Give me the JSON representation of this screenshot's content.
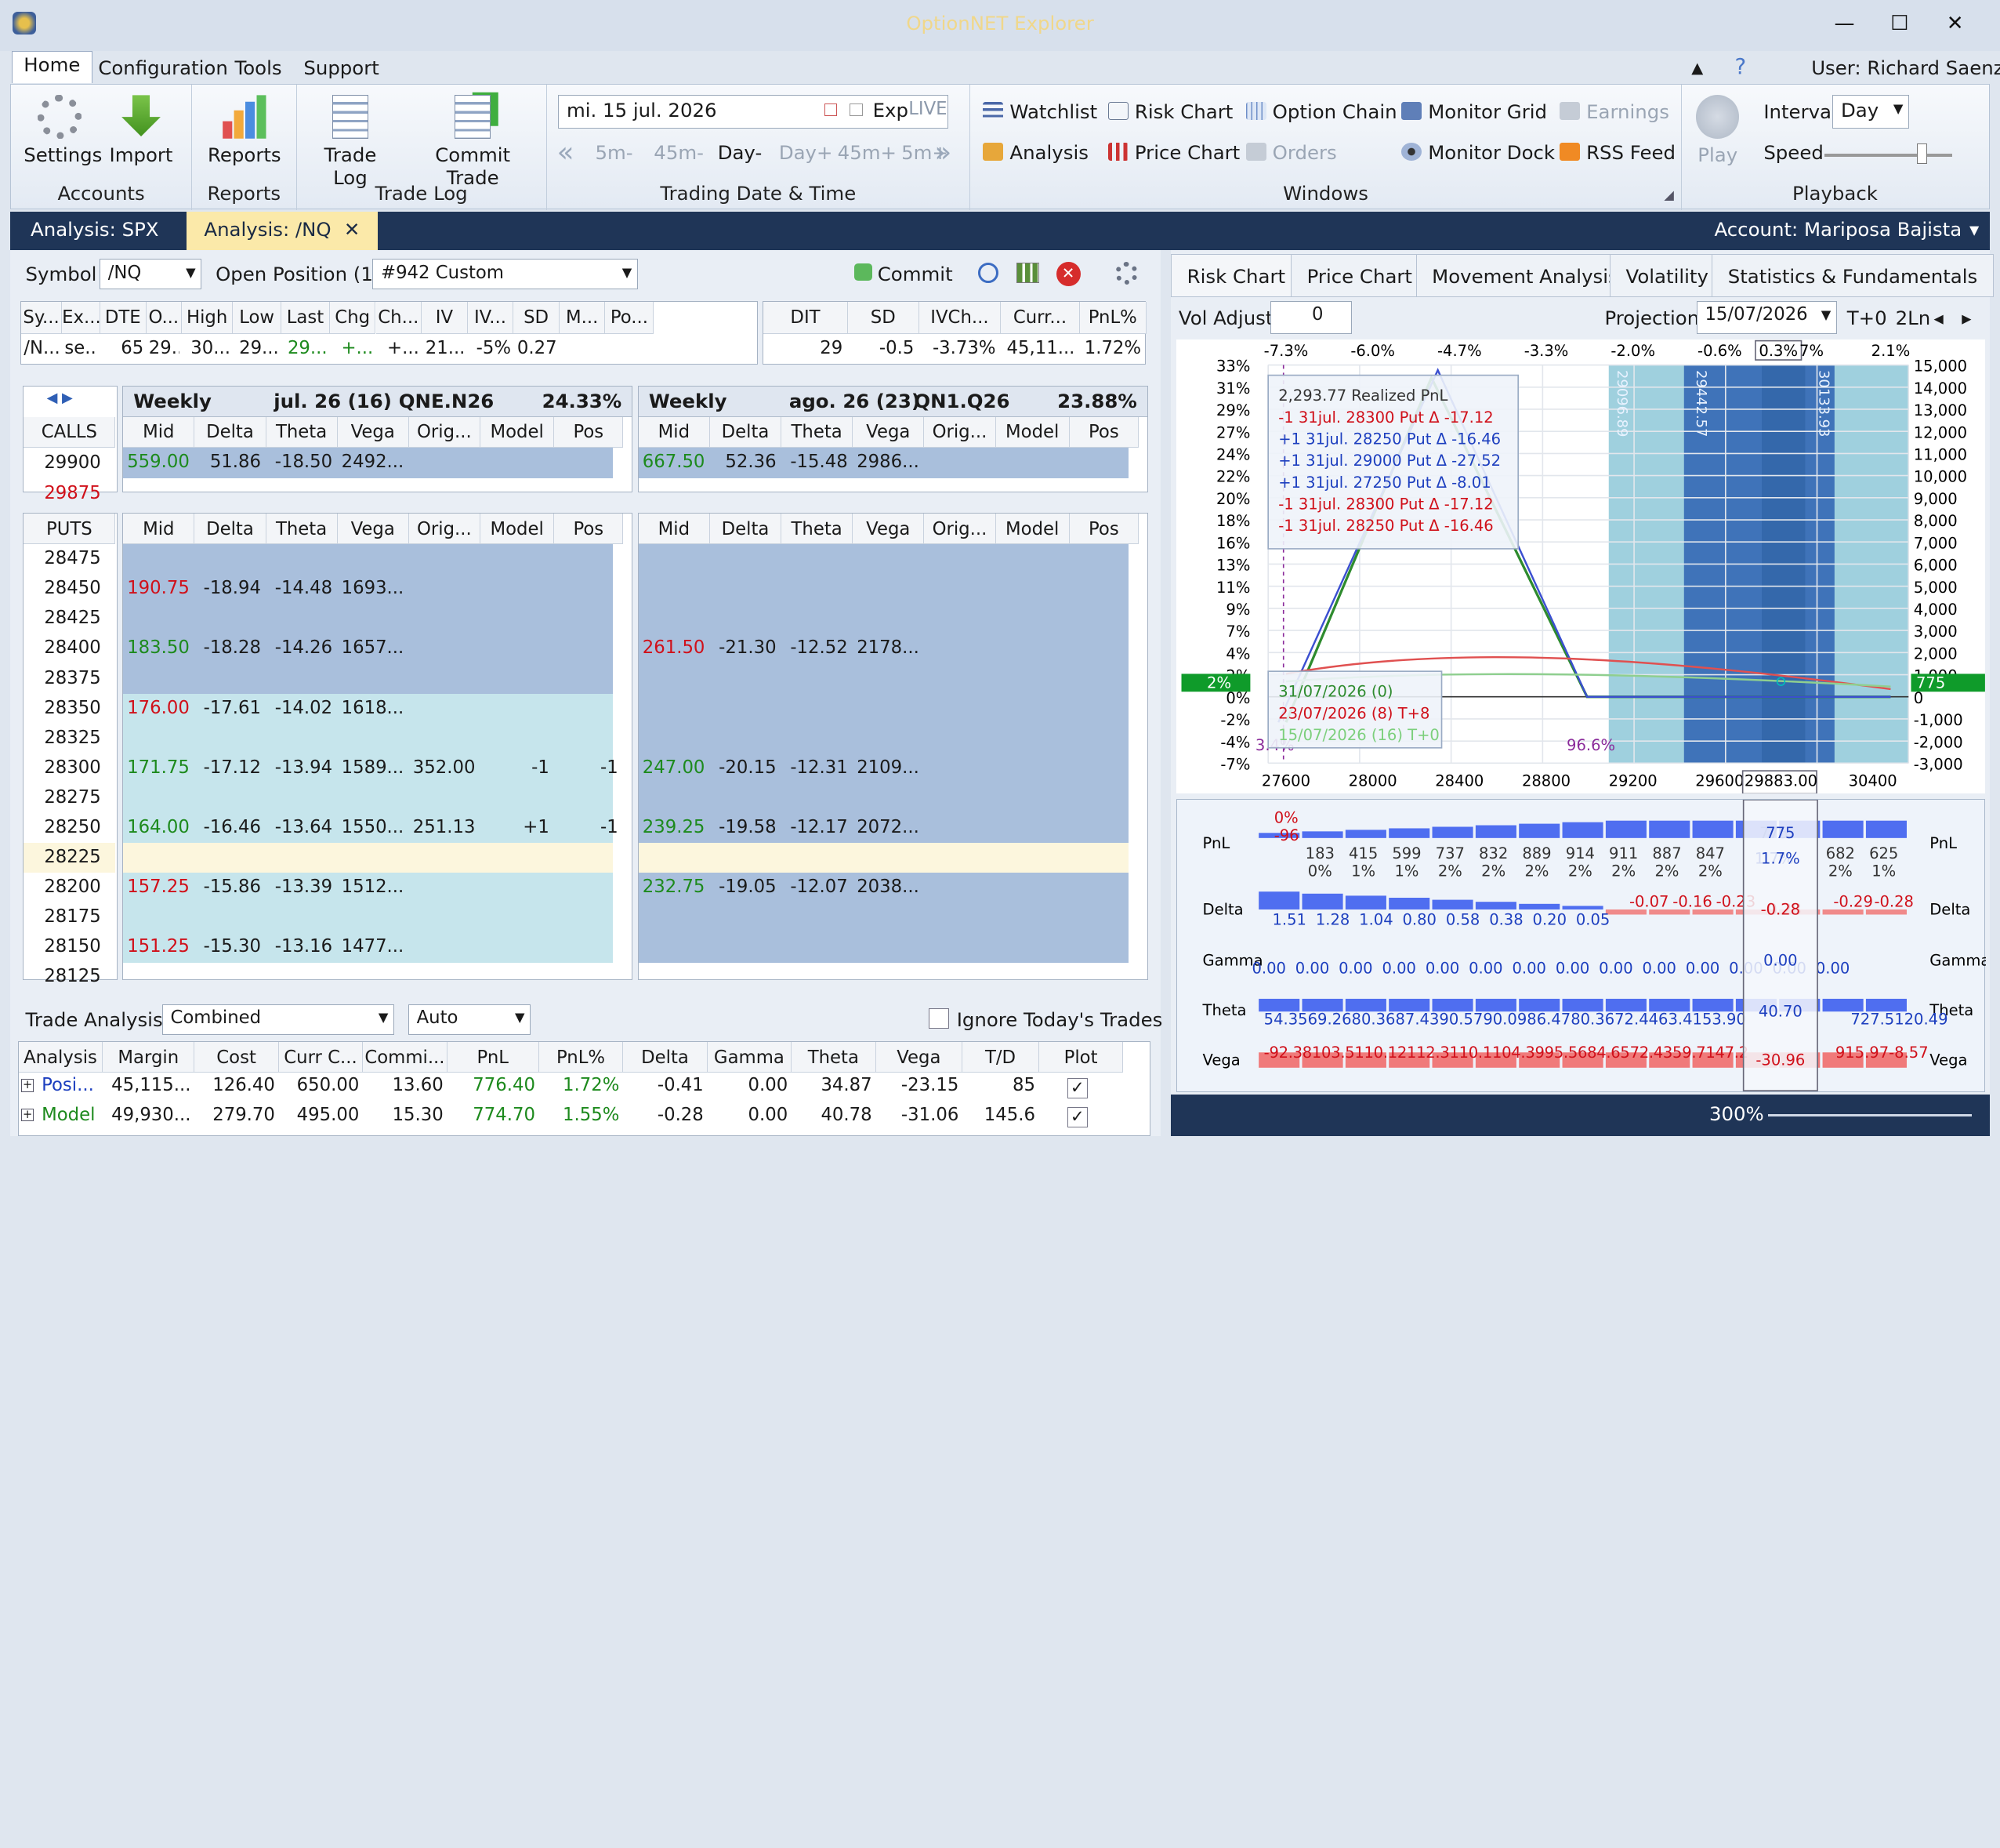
{
  "app": {
    "title": "OptionNET Explorer",
    "user": "User: Richard Saenz"
  },
  "menu": [
    "Home",
    "Configuration",
    "Tools",
    "Support"
  ],
  "ribbon": {
    "accounts": {
      "label": "Accounts",
      "settings": "Settings",
      "import": "Import"
    },
    "reports": {
      "label": "Reports",
      "reports": "Reports"
    },
    "tradelog": {
      "label": "Trade Log",
      "trade_log": "Trade Log",
      "commit_trade": "Commit Trade"
    },
    "trading": {
      "label": "Trading Date & Time",
      "date": "mi. 15 jul. 2026",
      "exp": "Exp",
      "live": "LIVE",
      "steps": [
        "5m-",
        "45m-",
        "Day-",
        "Day+",
        "45m+",
        "5m+"
      ]
    },
    "windows": {
      "label": "Windows",
      "items": [
        "Watchlist",
        "Risk Chart",
        "Option Chain",
        "Monitor Grid",
        "Earnings",
        "Analysis",
        "Price Chart",
        "Orders",
        "Monitor Dock",
        "RSS Feed"
      ]
    },
    "playback": {
      "label": "Playback",
      "play": "Play",
      "interval_label": "Interval",
      "interval": "Day",
      "speed_label": "Speed"
    }
  },
  "doc_tabs": [
    "Analysis: SPX",
    "Analysis: /NQ"
  ],
  "account": "Account: Mariposa Bajista",
  "left": {
    "symbol_label": "Symbol",
    "symbol": "/NQ",
    "open_pos_label": "Open Position (1)",
    "position": "#942 Custom",
    "commit": "Commit",
    "quote_headers": [
      "Sy...",
      "Ex...",
      "DTE",
      "O...",
      "High",
      "Low",
      "Last",
      "Chg",
      "Ch...",
      "IV",
      "IV...",
      "SD",
      "M...",
      "Po..."
    ],
    "quote_values": [
      "/N...",
      "se...",
      "65",
      "29...",
      "30...",
      "29...",
      "29...",
      "+...",
      "+...",
      "21...",
      "-5%",
      "0.27",
      "",
      ""
    ],
    "pos_headers": [
      "DIT",
      "SD",
      "IVCh...",
      "Curr...",
      "PnL%"
    ],
    "pos_values": [
      "29",
      "-0.5",
      "-3.73%",
      "45,11...",
      "1.72%"
    ],
    "exp1": {
      "name": "Weekly",
      "date": "jul. 26 (16)",
      "code": "QNE.N26",
      "iv": "24.33%"
    },
    "exp2": {
      "name": "Weekly",
      "date": "ago. 26 (23)",
      "code": "QN1.Q26",
      "iv": "23.88%"
    },
    "opt_cols": [
      "Mid",
      "Delta",
      "Theta",
      "Vega",
      "Orig...",
      "Model",
      "Pos"
    ],
    "calls_label": "CALLS",
    "puts_label": "PUTS",
    "calls": [
      {
        "strike": "29900",
        "a": [
          "559.00",
          "51.86",
          "-18.50",
          "2492...",
          "",
          "",
          ""
        ],
        "b": [
          "667.50",
          "52.36",
          "-15.48",
          "2986...",
          "",
          "",
          ""
        ]
      },
      {
        "strike": "29875",
        "a": [],
        "b": []
      }
    ],
    "puts": [
      {
        "strike": "28475",
        "a": [
          "",
          "",
          "",
          "",
          "",
          "",
          ""
        ],
        "b": [
          "",
          "",
          "",
          "",
          "",
          "",
          ""
        ]
      },
      {
        "strike": "28450",
        "a": [
          "190.75",
          "-18.94",
          "-14.48",
          "1693...",
          "",
          "",
          ""
        ],
        "b": [
          "",
          "",
          "",
          "",
          "",
          "",
          ""
        ]
      },
      {
        "strike": "28425",
        "a": [
          "",
          "",
          "",
          "",
          "",
          "",
          ""
        ],
        "b": [
          "",
          "",
          "",
          "",
          "",
          "",
          ""
        ]
      },
      {
        "strike": "28400",
        "a": [
          "183.50",
          "-18.28",
          "-14.26",
          "1657...",
          "",
          "",
          ""
        ],
        "b": [
          "261.50",
          "-21.30",
          "-12.52",
          "2178...",
          "",
          "",
          ""
        ]
      },
      {
        "strike": "28375",
        "a": [
          "",
          "",
          "",
          "",
          "",
          "",
          ""
        ],
        "b": [
          "",
          "",
          "",
          "",
          "",
          "",
          ""
        ]
      },
      {
        "strike": "28350",
        "a": [
          "176.00",
          "-17.61",
          "-14.02",
          "1618...",
          "",
          "",
          ""
        ],
        "b": [
          "",
          "",
          "",
          "",
          "",
          "",
          ""
        ]
      },
      {
        "strike": "28325",
        "a": [
          "",
          "",
          "",
          "",
          "",
          "",
          ""
        ],
        "b": [
          "",
          "",
          "",
          "",
          "",
          "",
          ""
        ]
      },
      {
        "strike": "28300",
        "a": [
          "171.75",
          "-17.12",
          "-13.94",
          "1589...",
          "352.00",
          "-1",
          "-1"
        ],
        "b": [
          "247.00",
          "-20.15",
          "-12.31",
          "2109...",
          "",
          "",
          ""
        ]
      },
      {
        "strike": "28275",
        "a": [
          "",
          "",
          "",
          "",
          "",
          "",
          ""
        ],
        "b": [
          "",
          "",
          "",
          "",
          "",
          "",
          ""
        ]
      },
      {
        "strike": "28250",
        "a": [
          "164.00",
          "-16.46",
          "-13.64",
          "1550...",
          "251.13",
          "+1",
          "-1"
        ],
        "b": [
          "239.25",
          "-19.58",
          "-12.17",
          "2072...",
          "",
          "",
          ""
        ]
      },
      {
        "strike": "28225",
        "a": [
          "",
          "",
          "",
          "",
          "",
          "",
          ""
        ],
        "b": [
          "",
          "",
          "",
          "",
          "",
          "",
          ""
        ]
      },
      {
        "strike": "28200",
        "a": [
          "157.25",
          "-15.86",
          "-13.39",
          "1512...",
          "",
          "",
          ""
        ],
        "b": [
          "232.75",
          "-19.05",
          "-12.07",
          "2038...",
          "",
          "",
          ""
        ]
      },
      {
        "strike": "28175",
        "a": [
          "",
          "",
          "",
          "",
          "",
          "",
          ""
        ],
        "b": [
          "",
          "",
          "",
          "",
          "",
          "",
          ""
        ]
      },
      {
        "strike": "28150",
        "a": [
          "151.25",
          "-15.30",
          "-13.16",
          "1477...",
          "",
          "",
          ""
        ],
        "b": [
          "",
          "",
          "",
          "",
          "",
          "",
          ""
        ]
      },
      {
        "strike": "28125",
        "a": [],
        "b": []
      }
    ],
    "trade_analysis": {
      "label": "Trade Analysis",
      "mode": "Combined",
      "auto": "Auto",
      "ignore": "Ignore Today's Trades",
      "headers": [
        "Analysis",
        "Margin",
        "Cost",
        "Curr C...",
        "Commi...",
        "PnL",
        "PnL%",
        "Delta",
        "Gamma",
        "Theta",
        "Vega",
        "T/D",
        "Plot"
      ],
      "rows": [
        [
          "Posi...",
          "45,115...",
          "126.40",
          "650.00",
          "13.60",
          "776.40",
          "1.72%",
          "-0.41",
          "0.00",
          "34.87",
          "-23.15",
          "85",
          ""
        ],
        [
          "Model",
          "49,930...",
          "279.70",
          "495.00",
          "15.30",
          "774.70",
          "1.55%",
          "-0.28",
          "0.00",
          "40.78",
          "-31.06",
          "145.6",
          ""
        ]
      ]
    }
  },
  "right": {
    "tabs": [
      "Risk Chart",
      "Price Chart",
      "Movement Analysis",
      "Volatility",
      "Statistics & Fundamentals"
    ],
    "vol_adjust_label": "Vol Adjust",
    "vol_adjust": "0",
    "projection_label": "Projection",
    "projection": "15/07/2026",
    "t0": "T+0",
    "ln": "2Ln",
    "chart_data": {
      "type": "line",
      "x_ticks": [
        "27600",
        "28000",
        "28400",
        "28800",
        "29200",
        "29600",
        "29883.00",
        "30400"
      ],
      "y_left": [
        "33%",
        "31%",
        "29%",
        "27%",
        "24%",
        "22%",
        "20%",
        "18%",
        "16%",
        "13%",
        "11%",
        "9%",
        "7%",
        "4%",
        "2%",
        "0%",
        "-2%",
        "-4%",
        "-7%"
      ],
      "y_right": [
        "15,000",
        "14,000",
        "13,000",
        "12,000",
        "11,000",
        "10,000",
        "9,000",
        "8,000",
        "7,000",
        "6,000",
        "5,000",
        "4,000",
        "3,000",
        "2,000",
        "1,000",
        "0",
        "-1,000",
        "-2,000",
        "-3,000"
      ],
      "top_pcts": [
        "-7.3%",
        "-6.0%",
        "-4.7%",
        "-3.3%",
        "-2.0%",
        "-0.6%",
        "0.3%",
        "7%",
        "2.1%"
      ],
      "bands": [
        "29096.89",
        "29442.57",
        "30133.93"
      ],
      "current_left": "2%",
      "current_right": "775",
      "marker_left": "3.4%",
      "marker_mid": "96.6%",
      "legend_top": [
        {
          "txt": "2,293.77 Realized PnL",
          "c": "#333"
        },
        {
          "txt": "-1 31jul. 28300 Put Δ  -17.12",
          "c": "#d0101a"
        },
        {
          "txt": "+1 31jul. 28250 Put Δ  -16.46",
          "c": "#1d3fbf"
        },
        {
          "txt": "+1 31jul. 29000 Put Δ  -27.52",
          "c": "#1d3fbf"
        },
        {
          "txt": "+1 31jul. 27250 Put Δ   -8.01",
          "c": "#1d3fbf"
        },
        {
          "txt": "-1 31jul. 28300 Put Δ  -17.12",
          "c": "#d0101a"
        },
        {
          "txt": "-1 31jul. 28250 Put Δ  -16.46",
          "c": "#d0101a"
        }
      ],
      "legend_bottom": [
        {
          "txt": "31/07/2026 (0)",
          "c": "#2e8b2e"
        },
        {
          "txt": "23/07/2026 (8) T+8",
          "c": "#d0101a"
        },
        {
          "txt": "15/07/2026 (16) T+0",
          "c": "#7ccf7c"
        }
      ]
    },
    "greeks": {
      "labels": [
        "PnL",
        "Delta",
        "Gamma",
        "Theta",
        "Vega"
      ],
      "pnl_top": [
        "0%",
        "-96"
      ],
      "pnl": [
        "183",
        "415",
        "599",
        "737",
        "832",
        "889",
        "914",
        "911",
        "887",
        "847",
        "775",
        "682",
        "625"
      ],
      "pnl_pct": [
        "0%",
        "1%",
        "1%",
        "2%",
        "2%",
        "2%",
        "2%",
        "2%",
        "2%",
        "2%",
        "1.7%",
        "2%",
        "1%"
      ],
      "delta_pos": [
        "1.51",
        "1.28",
        "1.04",
        "0.80",
        "0.58",
        "0.38",
        "0.20",
        "0.05"
      ],
      "delta_neg": [
        "-0.07",
        "-0.16",
        "-0.23",
        "-0.28",
        "-0.29",
        "-0.28"
      ],
      "gamma": [
        "0.00",
        "0.00",
        "0.00",
        "0.00",
        "0.00",
        "0.00",
        "0.00",
        "0.00",
        "0.00",
        "0.00",
        "0.00",
        "0.00",
        "0.00",
        "0.00"
      ],
      "theta": "54.3569.2680.3687.4390.5790.0986.4780.3672.4463.4153.90",
      "theta_sel": "40.70",
      "theta_right": "727.5120.49",
      "vega": "-92.38103.5110.12112.3110.1104.3995.5684.6572.4359.7147.2",
      "vega_sel": "-30.96",
      "vega_right": "915.97-8.57",
      "sel_x": "29883.00",
      "sel_pnl": "775",
      "sel_pct": "1.7%",
      "sel_delta": "-0.28",
      "sel_gamma": "0.00"
    },
    "zoom": "300%"
  }
}
